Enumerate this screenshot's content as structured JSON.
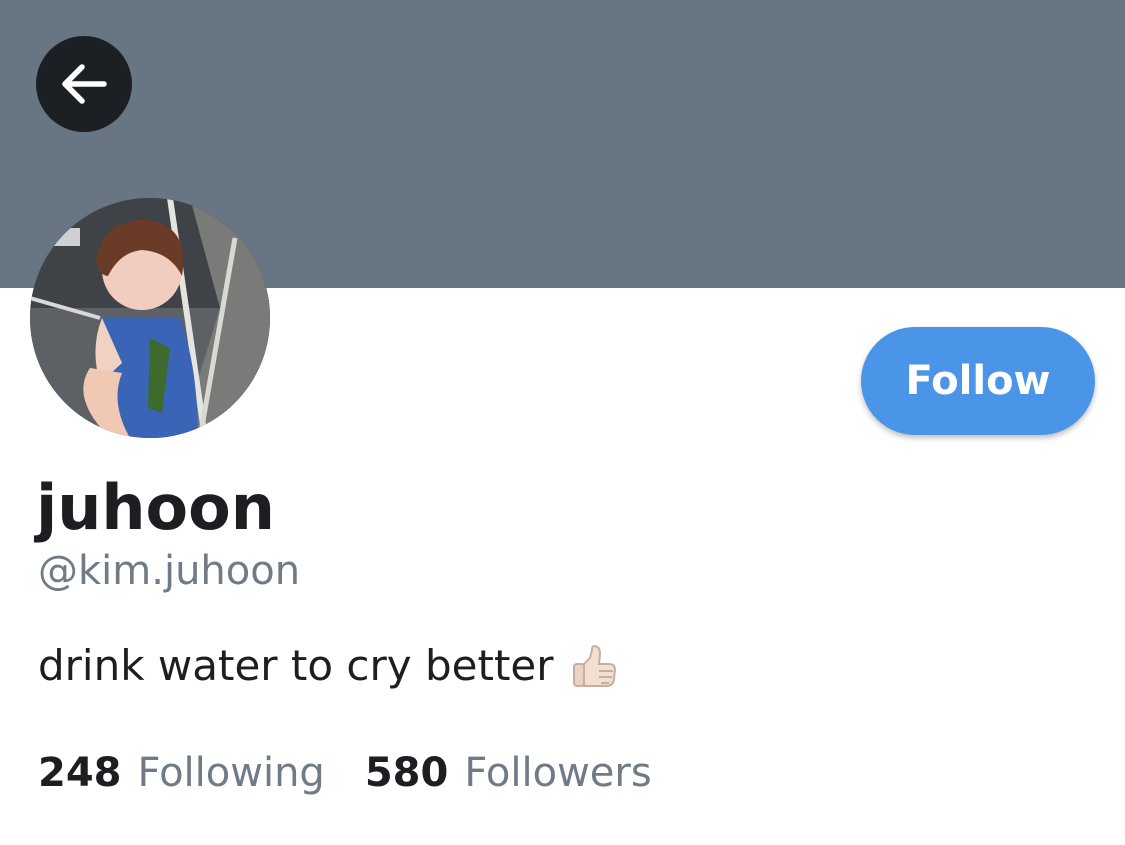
{
  "header": {
    "banner_color": "#687684",
    "back_icon": "arrow-left-icon"
  },
  "profile": {
    "display_name": "juhoon",
    "handle": "@kim.juhoon",
    "bio_text": "drink water to cry better",
    "bio_emoji": "thumbs-up-icon",
    "avatar_icon": "avatar-photo"
  },
  "actions": {
    "follow_label": "Follow",
    "follow_color": "#4a95e8"
  },
  "stats": {
    "following_count": "248",
    "following_label": "Following",
    "followers_count": "580",
    "followers_label": "Followers"
  }
}
